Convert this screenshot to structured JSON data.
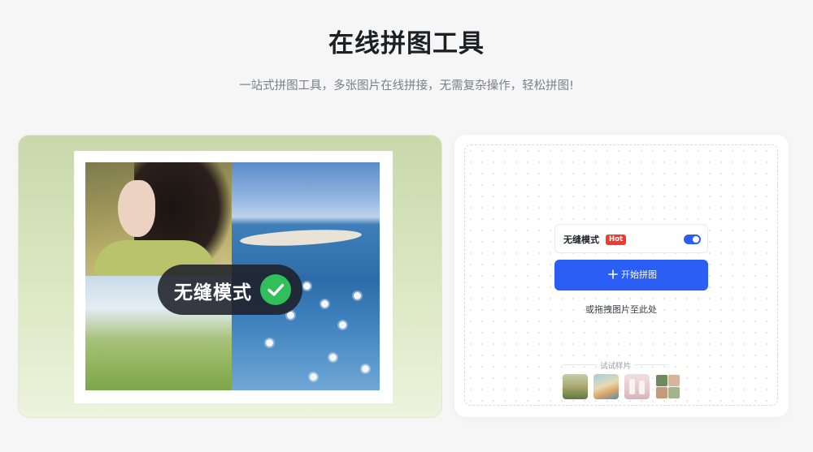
{
  "header": {
    "title": "在线拼图工具",
    "subtitle": "一站式拼图工具，多张图片在线拼接，无需复杂操作，轻松拼图!"
  },
  "demo": {
    "badge_text": "无缝模式"
  },
  "upload": {
    "seamless_label": "无缝模式",
    "hot_tag": "Hot",
    "seamless_enabled": true,
    "start_button_label": "开始拼图",
    "drag_hint": "或拖拽图片至此处",
    "samples_title": "试试样片",
    "sample_count": 4
  },
  "colors": {
    "accent": "#2a5ef5",
    "hot": "#ef3b2f",
    "check": "#2fbf5b"
  },
  "icons": [
    "plus-icon",
    "check-icon"
  ]
}
